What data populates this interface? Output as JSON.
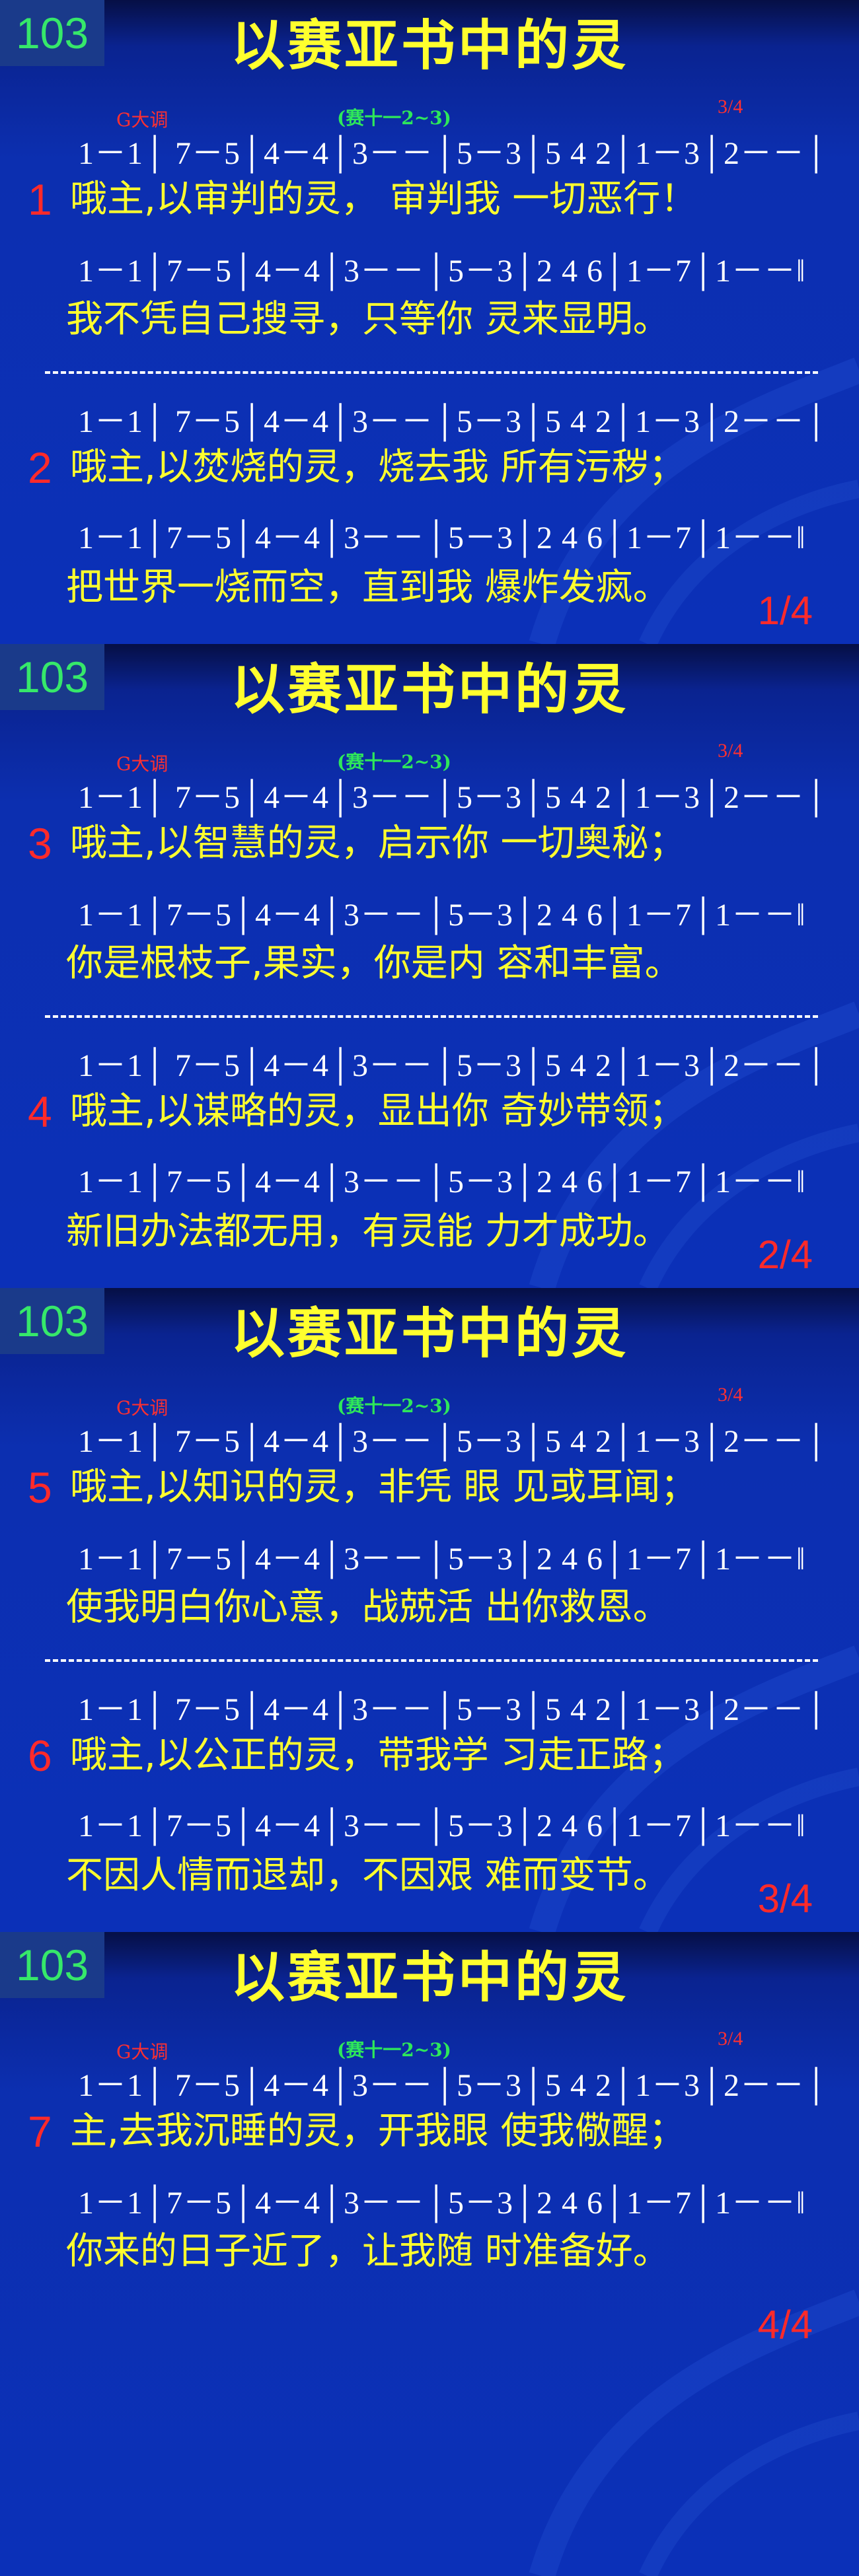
{
  "hymn_number": "103",
  "title": "以赛亚书中的灵",
  "key": "G大调",
  "reference": "(赛十一2~3)",
  "time_signature": "3/4",
  "notation_line_a": "1－1│ 7－5│4－4│3－－│5－3│5 4  2│1－3│2－－│",
  "notation_line_b": "1－1│7－5│4－4│3－－│5－3│2 4  6│1－7│1－－‖",
  "slides": [
    {
      "page": "1/4",
      "verses": [
        {
          "number": "1",
          "line1": "哦主,以审判的灵， 审判我  一切恶行！",
          "line2": "我不凭自己搜寻，只等你   灵来显明。"
        },
        {
          "number": "2",
          "line1": "哦主,以焚烧的灵，烧去我   所有污秽；",
          "line2": "把世界一烧而空，直到我   爆炸发疯。"
        }
      ]
    },
    {
      "page": "2/4",
      "verses": [
        {
          "number": "3",
          "line1": "哦主,以智慧的灵，启示你    一切奥秘；",
          "line2": "你是根枝子,果实，你是内   容和丰富。"
        },
        {
          "number": "4",
          "line1": "哦主,以谋略的灵，显出你   奇妙带领；",
          "line2": "新旧办法都无用，有灵能   力才成功。"
        }
      ]
    },
    {
      "page": "3/4",
      "verses": [
        {
          "number": "5",
          "line1": "哦主,以知识的灵，非凭 眼  见或耳闻；",
          "line2": "使我明白你心意，战兢活   出你救恩。"
        },
        {
          "number": "6",
          "line1": "哦主,以公正的灵，带我学   习走正路；",
          "line2": "不因人情而退却，不因艰   难而变节。"
        }
      ]
    },
    {
      "page": "4/4",
      "verses": [
        {
          "number": "7",
          "line1": "主,去我沉睡的灵，开我眼    使我儆醒；",
          "line2": "你来的日子近了，让我随   时准备好。"
        }
      ]
    }
  ]
}
